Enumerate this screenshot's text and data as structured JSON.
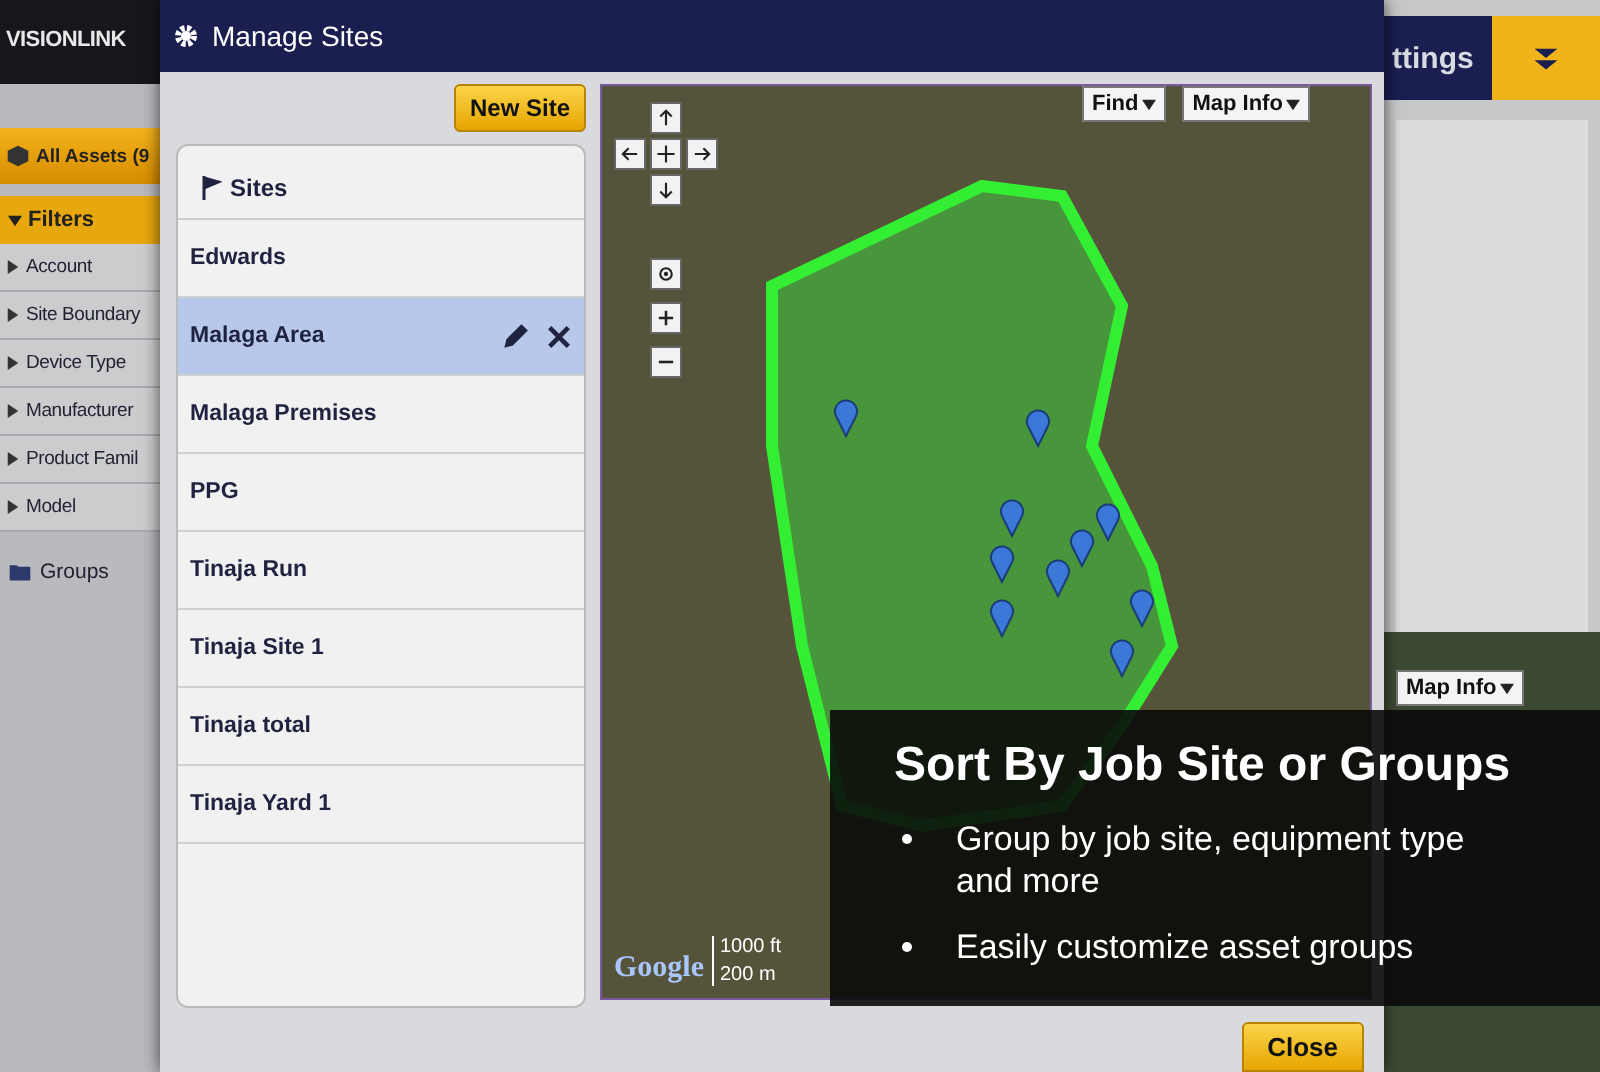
{
  "background_app": {
    "logo": "VISIONLINK",
    "header_tab": "ttings",
    "asset_bar": "All Assets (9",
    "filters": {
      "label": "Filters",
      "expanded": true,
      "items": [
        "Account",
        "Site Boundary",
        "Device Type",
        "Manufacturer",
        "Product Famil",
        "Model"
      ]
    },
    "groups": "Groups",
    "map_info_button": "Map Info"
  },
  "dialog": {
    "title": "Manage Sites",
    "new_site_button": "New Site",
    "sites_header": "Sites",
    "sites": [
      {
        "name": "Edwards",
        "selected": false
      },
      {
        "name": "Malaga Area",
        "selected": true
      },
      {
        "name": "Malaga Premises",
        "selected": false
      },
      {
        "name": "PPG",
        "selected": false
      },
      {
        "name": "Tinaja Run",
        "selected": false
      },
      {
        "name": "Tinaja Site 1",
        "selected": false
      },
      {
        "name": "Tinaja total",
        "selected": false
      },
      {
        "name": "Tinaja Yard 1",
        "selected": false
      }
    ],
    "map": {
      "find_button": "Find",
      "map_info_button": "Map Info",
      "scale_imperial": "1000 ft",
      "scale_metric": "200 m",
      "provider_logo": "Google"
    },
    "close_button": "Close"
  },
  "slide_overlay": {
    "heading": "Sort By Job Site or Groups",
    "bullets": [
      "Group by job site, equipment type and more",
      "Easily customize asset groups"
    ]
  }
}
